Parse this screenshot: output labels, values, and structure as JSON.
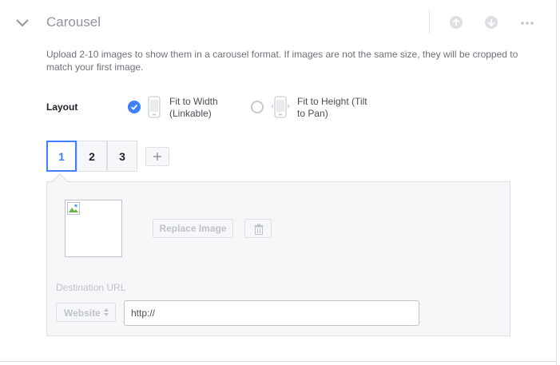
{
  "header": {
    "title": "Carousel",
    "icons": [
      "chevron-down-icon",
      "arrow-up-icon",
      "arrow-down-icon",
      "more-icon"
    ]
  },
  "description": "Upload 2-10 images to show them in a carousel format. If images are not the same size, they will be cropped to match your first image.",
  "layout": {
    "label": "Layout",
    "options": [
      {
        "line1": "Fit to Width",
        "line2": "(Linkable)",
        "selected": true
      },
      {
        "line1": "Fit to Height (Tilt",
        "line2": "to Pan)",
        "selected": false
      }
    ]
  },
  "tabs": [
    "1",
    "2",
    "3"
  ],
  "add_icon": "plus-icon",
  "card": {
    "replace_label": "Replace Image",
    "trash_icon": "trash-icon",
    "destination_label": "Destination URL",
    "website_select": "Website",
    "url_value": "http://"
  },
  "colors": {
    "accent": "#4080ff",
    "border": "#dddfe2",
    "muted": "#90949c",
    "disabled": "#bec3c9"
  }
}
